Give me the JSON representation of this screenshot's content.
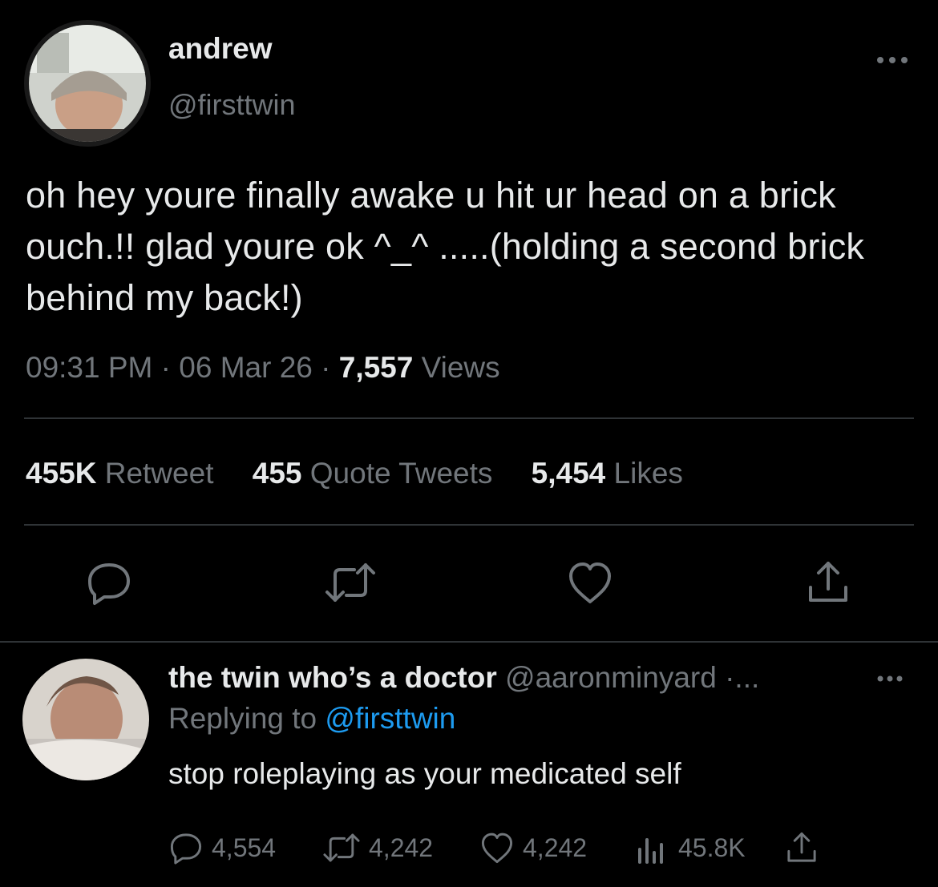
{
  "tweet": {
    "author_name": "andrew",
    "author_handle": "@firsttwin",
    "text": "oh hey youre finally awake u hit ur head on a brick ouch.!! glad youre ok ^_^ .....(holding a second brick behind my back!)",
    "time": "09:31 PM",
    "date": "06 Mar 26",
    "views_count": "7,557",
    "views_label": "Views",
    "sep": "·",
    "stats": {
      "retweets_count": "455K",
      "retweets_label": "Retweet",
      "quotes_count": "455",
      "quotes_label": "Quote Tweets",
      "likes_count": "5,454",
      "likes_label": "Likes"
    },
    "actions": [
      "reply-icon",
      "retweet-icon",
      "like-icon",
      "share-icon"
    ],
    "more_icon": "more-icon"
  },
  "reply": {
    "author_name": "the twin who’s a doctor",
    "author_handle": "@aaronminyard ·...",
    "replying_prefix": "Replying to",
    "replying_handle": "@firsttwin",
    "text": "stop roleplaying as your medicated self",
    "counts": {
      "replies": "4,554",
      "retweets": "4,242",
      "likes": "4,242",
      "views": "45.8K"
    }
  },
  "colors": {
    "background": "#000000",
    "text": "#e7e9ea",
    "muted": "#71767b",
    "link": "#1d9bf0",
    "divider": "#2f3336"
  }
}
